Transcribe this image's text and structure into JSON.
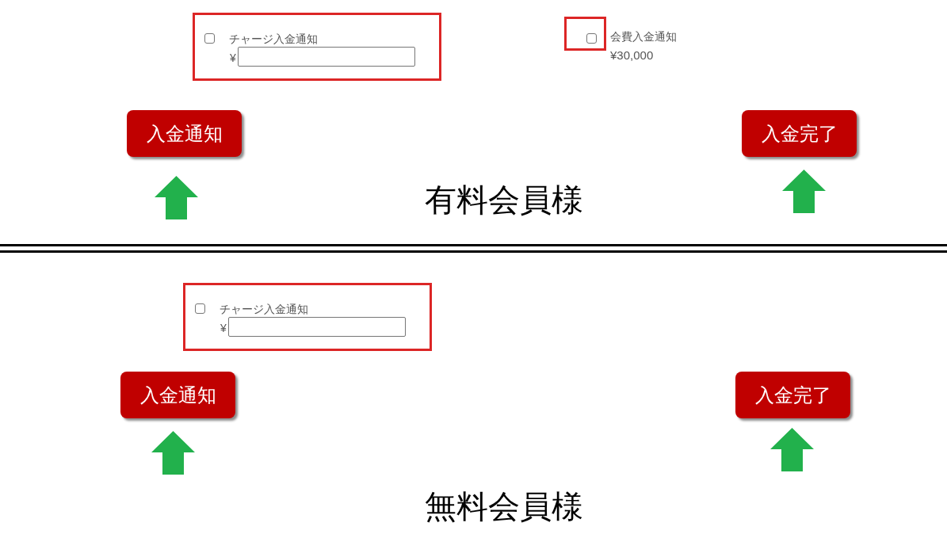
{
  "sections": [
    {
      "title": "有料会員様",
      "fields": [
        {
          "kind": "charge",
          "label": "チャージ入金通知",
          "currency": "¥",
          "checked": false
        },
        {
          "kind": "fee",
          "label": "会費入金通知",
          "amount": "¥30,000",
          "checked": false
        }
      ],
      "buttons": [
        "入金通知",
        "入金完了"
      ]
    },
    {
      "title": "無料会員様",
      "fields": [
        {
          "kind": "charge",
          "label": "チャージ入金通知",
          "currency": "¥",
          "checked": false
        }
      ],
      "buttons": [
        "入金通知",
        "入金完了"
      ]
    }
  ]
}
